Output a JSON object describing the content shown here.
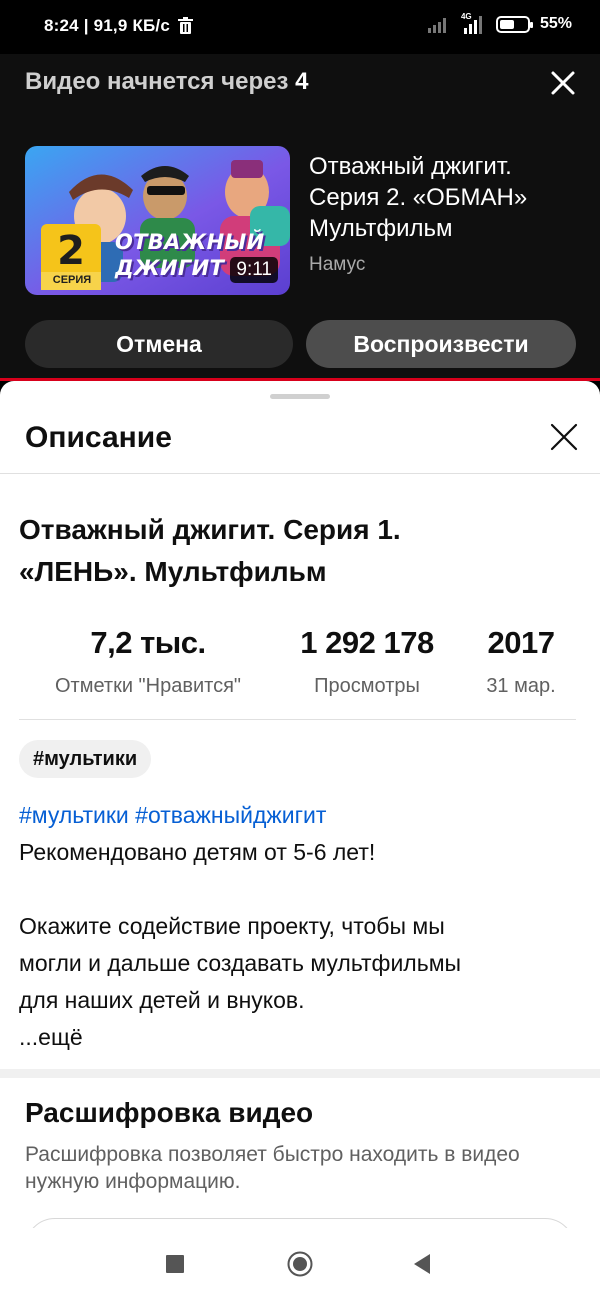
{
  "status_bar": {
    "time_speed": "8:24 | 91,9 КБ/с",
    "network": "4G",
    "battery_percent": "55%",
    "battery_level": 0.55
  },
  "autoplay": {
    "countdown_label": "Видео начнется через",
    "countdown_seconds": "4",
    "next_video": {
      "title_lines": [
        "Отважный джигит.",
        "Серия 2. «ОБМАН»",
        "Мультфильм"
      ],
      "channel": "Намус",
      "duration": "9:11",
      "thumbnail_number": "2",
      "thumbnail_series": "СЕРИЯ",
      "thumbnail_word1": "ОТВАЖНЫЙ",
      "thumbnail_word2": "ДЖИГИТ"
    },
    "cancel_label": "Отмена",
    "play_label": "Воспроизвести"
  },
  "description": {
    "heading": "Описание",
    "video_title_lines": [
      "Отважный джигит. Серия 1.",
      "«ЛЕНЬ». Мультфильм"
    ],
    "stats": {
      "likes_value": "7,2 тыс.",
      "likes_label": "Отметки \"Нравится\"",
      "views_value": "1 292 178",
      "views_label": "Просмотры",
      "year_value": "2017",
      "date_label": "31 мар."
    },
    "chip": "#мультики",
    "hashtags": [
      "#мультики",
      "#отважныйджигит"
    ],
    "lines": [
      "Рекомендовано детям от 5-6 лет!",
      "Окажите содействие проекту, чтобы мы",
      "могли и дальше создавать мультфильмы",
      "для наших детей и внуков.",
      "...ещё"
    ]
  },
  "transcript": {
    "title": "Расшифровка видео",
    "subtitle": "Расшифровка позволяет быстро находить в видео нужную информацию."
  },
  "colors": {
    "accent_red": "#d8001b",
    "link_blue": "#065fd4"
  }
}
